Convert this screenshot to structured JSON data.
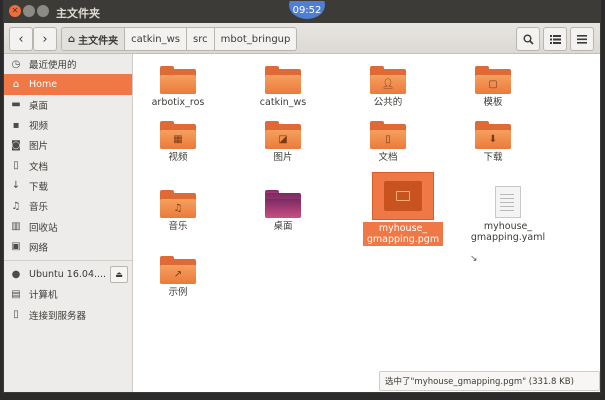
{
  "window": {
    "title": "主文件夹",
    "clock": "09:52"
  },
  "toolbar": {
    "back_icon": "chevron-left-icon",
    "forward_icon": "chevron-right-icon",
    "breadcrumbs": [
      "主文件夹",
      "catkin_ws",
      "src",
      "mbot_bringup"
    ],
    "search_icon": "search-icon",
    "list_view_icon": "list-view-icon",
    "menu_icon": "menu-icon"
  },
  "sidebar": {
    "items": [
      {
        "label": "最近使用的",
        "icon": "clock-icon"
      },
      {
        "label": "Home",
        "icon": "home-icon",
        "active": true
      },
      {
        "label": "桌面",
        "icon": "folder-icon"
      },
      {
        "label": "视频",
        "icon": "video-icon"
      },
      {
        "label": "图片",
        "icon": "camera-icon"
      },
      {
        "label": "文档",
        "icon": "document-icon"
      },
      {
        "label": "下载",
        "icon": "download-icon"
      },
      {
        "label": "音乐",
        "icon": "music-icon"
      },
      {
        "label": "回收站",
        "icon": "trash-icon"
      },
      {
        "label": "网络",
        "icon": "network-icon"
      }
    ],
    "devices": [
      {
        "label": "Ubuntu 16.04....",
        "icon": "disk-icon"
      },
      {
        "label": "计算机",
        "icon": "computer-icon"
      },
      {
        "label": "连接到服务器",
        "icon": "server-icon"
      }
    ]
  },
  "files": [
    {
      "name": "arbotix_ros",
      "type": "folder"
    },
    {
      "name": "catkin_ws",
      "type": "folder"
    },
    {
      "name": "公共的",
      "type": "folder",
      "emblem": "person-icon"
    },
    {
      "name": "模板",
      "type": "folder",
      "emblem": "template-icon"
    },
    {
      "name": "视频",
      "type": "folder",
      "emblem": "film-icon"
    },
    {
      "name": "图片",
      "type": "folder",
      "emblem": "picture-icon"
    },
    {
      "name": "文档",
      "type": "folder",
      "emblem": "document-icon"
    },
    {
      "name": "下载",
      "type": "folder",
      "emblem": "download-icon"
    },
    {
      "name": "音乐",
      "type": "folder",
      "emblem": "music-icon"
    },
    {
      "name": "桌面",
      "type": "desktop"
    },
    {
      "name": "myhouse_\ngmapping.pgm",
      "line1": "myhouse_",
      "line2": "gmapping.pgm",
      "type": "image",
      "selected": true
    },
    {
      "name": "myhouse_\ngmapping.yaml",
      "line1": "myhouse_",
      "line2": "gmapping.yaml",
      "type": "text"
    },
    {
      "name": "示例",
      "type": "folder",
      "emblem": "link-icon"
    }
  ],
  "status": {
    "text": "选中了\"myhouse_gmapping.pgm\" (331.8 KB)"
  }
}
